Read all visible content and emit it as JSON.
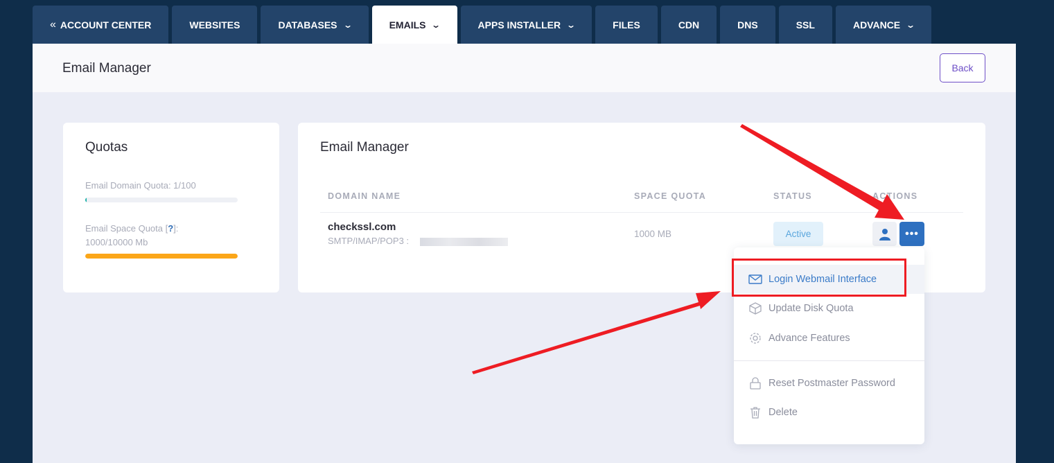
{
  "tabs": [
    {
      "label": "ACCOUNT CENTER",
      "prefix": "«",
      "dropdown": false,
      "active": false
    },
    {
      "label": "WEBSITES",
      "dropdown": false,
      "active": false
    },
    {
      "label": "DATABASES",
      "dropdown": true,
      "active": false
    },
    {
      "label": "EMAILS",
      "dropdown": true,
      "active": true
    },
    {
      "label": "APPS INSTALLER",
      "dropdown": true,
      "active": false
    },
    {
      "label": "FILES",
      "dropdown": false,
      "active": false
    },
    {
      "label": "CDN",
      "dropdown": false,
      "active": false
    },
    {
      "label": "DNS",
      "dropdown": false,
      "active": false
    },
    {
      "label": "SSL",
      "dropdown": false,
      "active": false
    },
    {
      "label": "ADVANCE",
      "dropdown": true,
      "active": false
    }
  ],
  "header": {
    "title": "Email Manager",
    "back_label": "Back"
  },
  "quotas": {
    "title": "Quotas",
    "domain_quota_label": "Email Domain Quota: 1/100",
    "domain_quota_fraction": 0.01,
    "space_quota_label_prefix": "Email Space Quota [",
    "space_quota_help": "?",
    "space_quota_label_suffix": "]:",
    "space_quota_value": "1000/10000 Mb",
    "space_quota_fraction": 1.0
  },
  "email_manager": {
    "title": "Email Manager",
    "columns": [
      "DOMAIN NAME",
      "SPACE QUOTA",
      "STATUS",
      "ACTIONS"
    ],
    "rows": [
      {
        "domain": "checkssl.com",
        "protocols": "SMTP/IMAP/POP3 :",
        "space_quota": "1000 MB",
        "status": "Active"
      }
    ]
  },
  "actions_menu": {
    "items": [
      {
        "label": "Login Webmail Interface",
        "icon": "mail-icon",
        "highlighted": true
      },
      {
        "label": "Update Disk Quota",
        "icon": "box-icon"
      },
      {
        "label": "Advance Features",
        "icon": "gear-icon"
      },
      {
        "label": "Reset Postmaster Password",
        "icon": "lock-icon"
      },
      {
        "label": "Delete",
        "icon": "trash-icon"
      }
    ]
  },
  "colors": {
    "background": "#0f2d4a",
    "tab": "#23446a",
    "accent": "#2e70c0",
    "back_button": "#6e4fc7",
    "status_bg": "#e2f1fb",
    "domain_bar": "#1bb1a8",
    "space_bar": "#fba619",
    "annotation": "#ee1c23"
  }
}
